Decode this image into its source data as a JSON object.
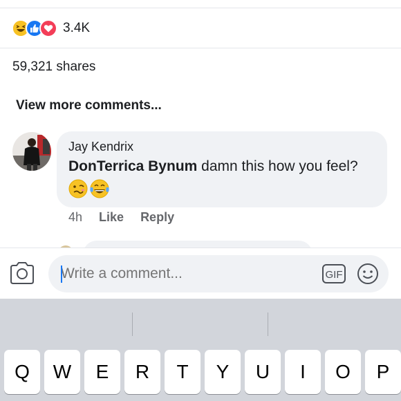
{
  "reactions": {
    "icons": [
      "laugh-emoji-icon",
      "like-thumb-icon",
      "love-heart-icon"
    ],
    "count": "3.4K",
    "colors": {
      "like": "#1877f2",
      "love": "#f33e58",
      "laugh": "#f7b125"
    }
  },
  "shares": {
    "label": "59,321 shares"
  },
  "comments": {
    "view_more": "View more comments...",
    "items": [
      {
        "author": "Jay Kendrix",
        "mention": "DonTerrica Bynum",
        "text": " damn this how you feel?",
        "emojis": [
          "woozy-face-icon",
          "tears-of-joy-icon"
        ],
        "time": "4h",
        "like_label": "Like",
        "reply_label": "Reply"
      }
    ]
  },
  "composer": {
    "placeholder": "Write a comment...",
    "gif_label": "GIF",
    "accent": "#1877f2"
  },
  "keyboard": {
    "row1": [
      "Q",
      "W",
      "E",
      "R",
      "T",
      "Y",
      "U",
      "I",
      "O",
      "P"
    ]
  }
}
